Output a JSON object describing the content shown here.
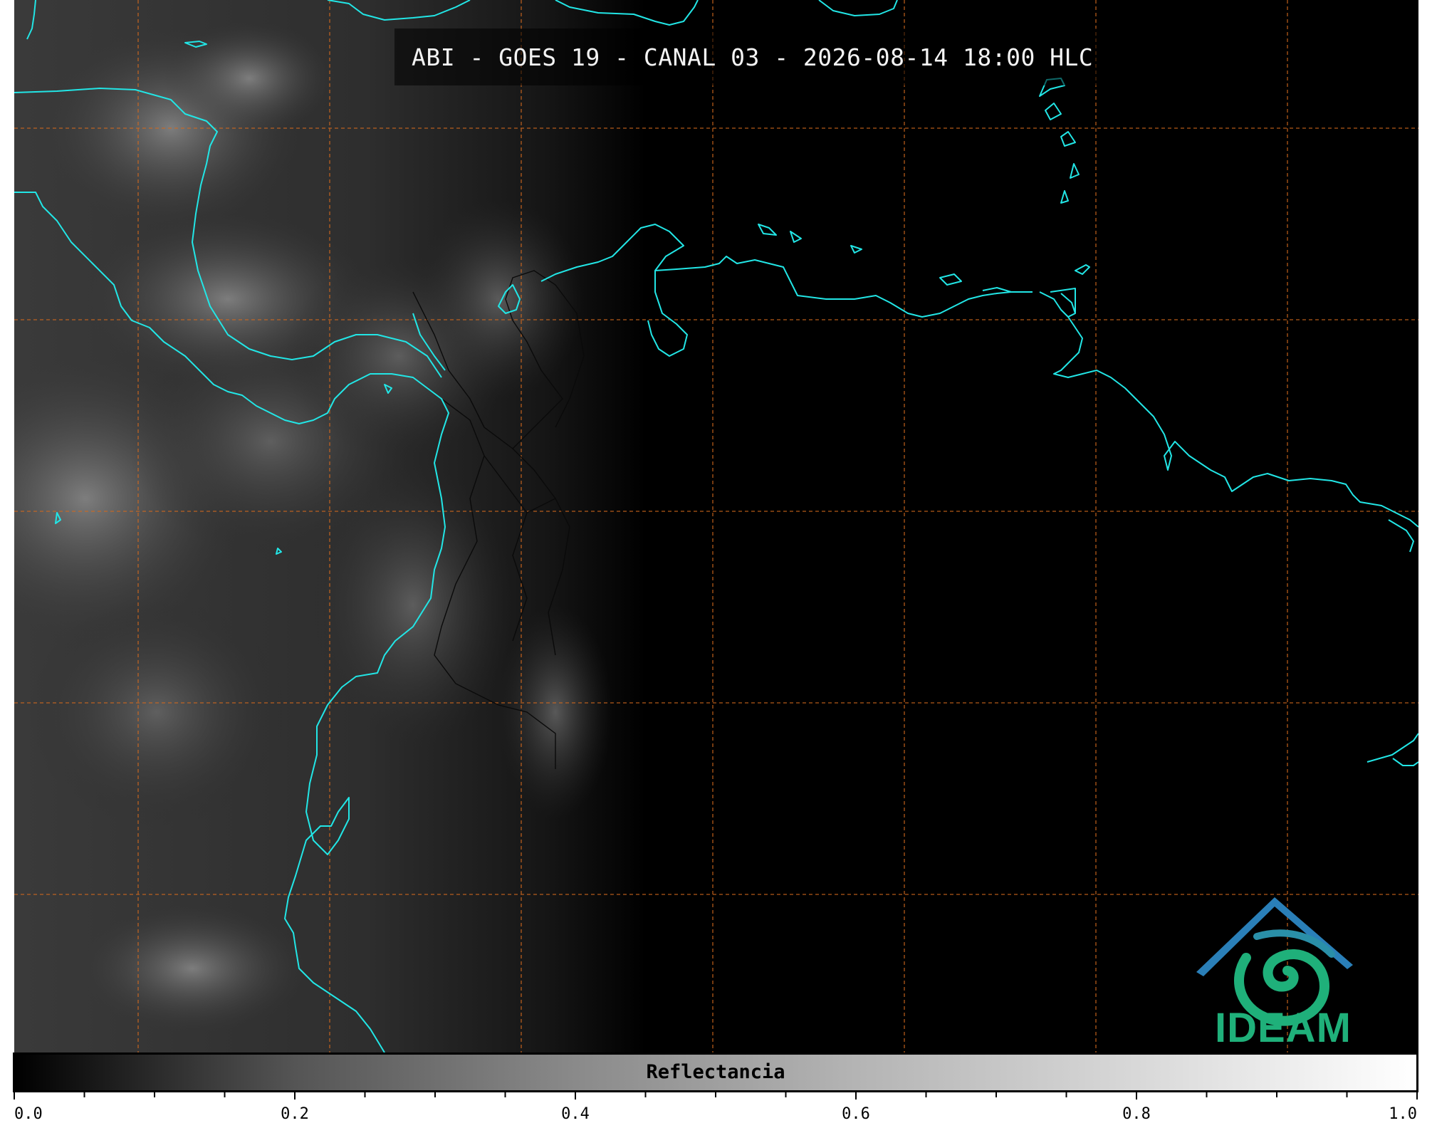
{
  "title": "ABI - GOES 19 - CANAL 03 - 2026-08-14 18:00 HLC",
  "colorbar": {
    "label": "Reflectancia",
    "ticks": [
      "0.0",
      "0.2",
      "0.4",
      "0.6",
      "0.8",
      "1.0"
    ],
    "range": [
      0.0,
      1.0
    ]
  },
  "logo": {
    "text": "IDEAM"
  },
  "colors": {
    "background": "#000000",
    "coastline": "#22e6e6",
    "gridlines": "#d2691e",
    "logo_primary": "#1fb07a",
    "logo_secondary": "#2a6fb3"
  },
  "map": {
    "gridlines": "dashed",
    "features": [
      "coastline",
      "political-borders",
      "cloud-reflectance"
    ]
  }
}
